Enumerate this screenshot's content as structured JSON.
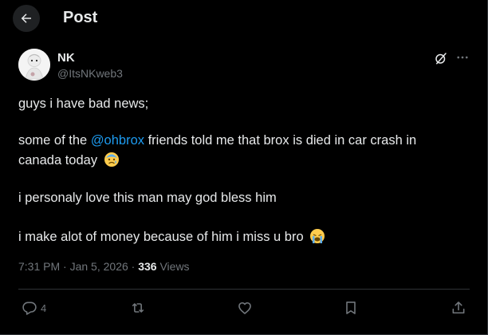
{
  "header": {
    "title": "Post"
  },
  "author": {
    "name": "NK",
    "handle": "@ItsNKweb3"
  },
  "tweet": {
    "line1": "guys i have bad news;",
    "line2_pre": "some of the ",
    "mention": "@ohbrox",
    "line2_post": " friends told me that brox is died in car crash in",
    "line3": "canada today",
    "line4": "i personaly love this man may god bless him",
    "line5": "i make alot of money because of him i miss u bro"
  },
  "meta": {
    "time": "7:31 PM",
    "sep1": " · ",
    "date": "Jan 5, 2026",
    "sep2": " · ",
    "views_count": "336",
    "views_label": " Views"
  },
  "actions": {
    "reply_count": "4"
  },
  "icons": [
    "back-arrow-icon",
    "grok-icon",
    "more-icon",
    "reply-icon",
    "retweet-icon",
    "like-icon",
    "bookmark-icon",
    "share-icon"
  ],
  "colors": {
    "background": "#000000",
    "text": "#e7e9ea",
    "muted": "#71767b",
    "link": "#1d9bf0",
    "border": "#2f3336"
  }
}
